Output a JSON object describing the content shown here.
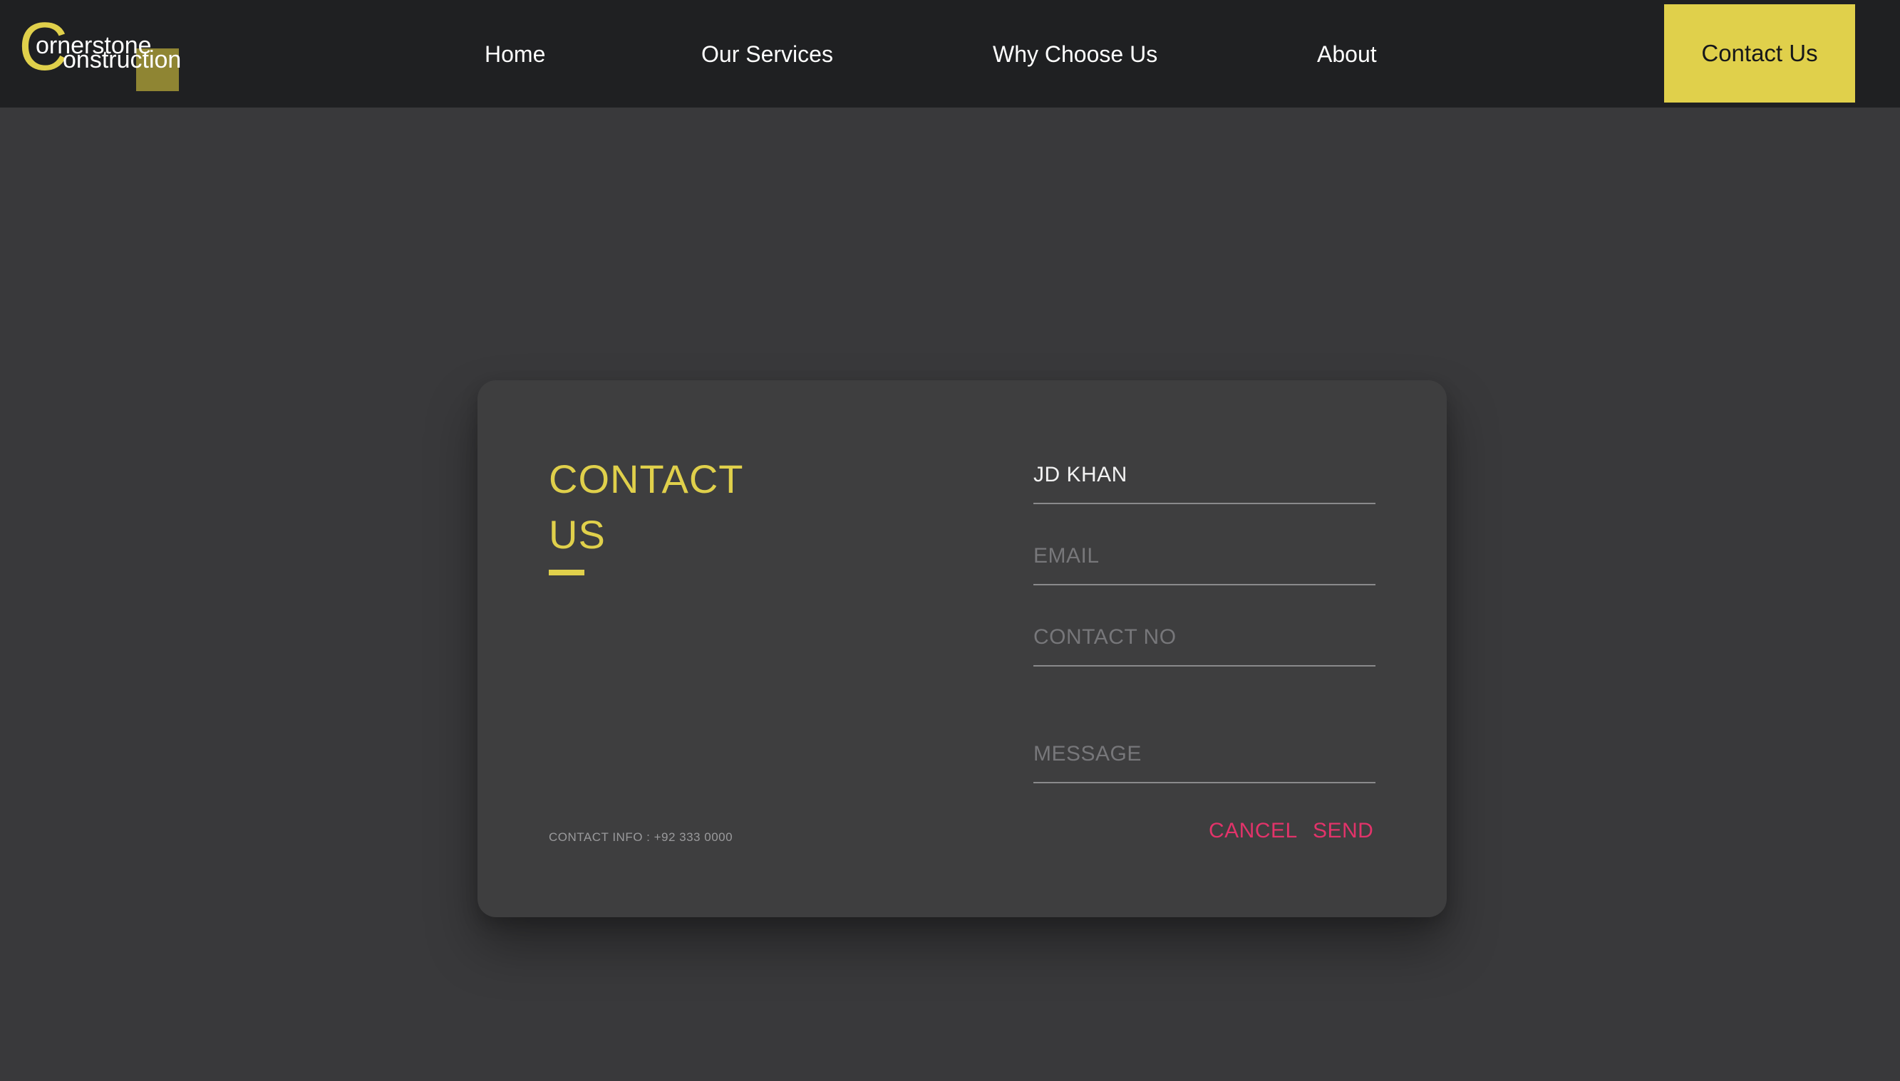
{
  "brand": {
    "logo_letter": "C",
    "line1": "ornerstone",
    "line2": "onstruction",
    "accent_color": "#e0d04b",
    "logo_square_color": "#8f8533"
  },
  "nav": {
    "items": [
      {
        "label": "Home"
      },
      {
        "label": "Our Services"
      },
      {
        "label": "Why Choose Us"
      },
      {
        "label": "About"
      }
    ],
    "cta_label": "Contact Us"
  },
  "contact_card": {
    "title": "CONTACT US",
    "info": "CONTACT INFO : +92 333 0000",
    "fields": {
      "name": {
        "value": "JD KHAN",
        "placeholder": ""
      },
      "email": {
        "value": "",
        "placeholder": "EMAIL"
      },
      "phone": {
        "value": "",
        "placeholder": "CONTACT NO"
      },
      "message": {
        "value": "",
        "placeholder": "MESSAGE"
      }
    },
    "cancel_label": "CANCEL",
    "send_label": "SEND",
    "action_color": "#e2336a"
  }
}
